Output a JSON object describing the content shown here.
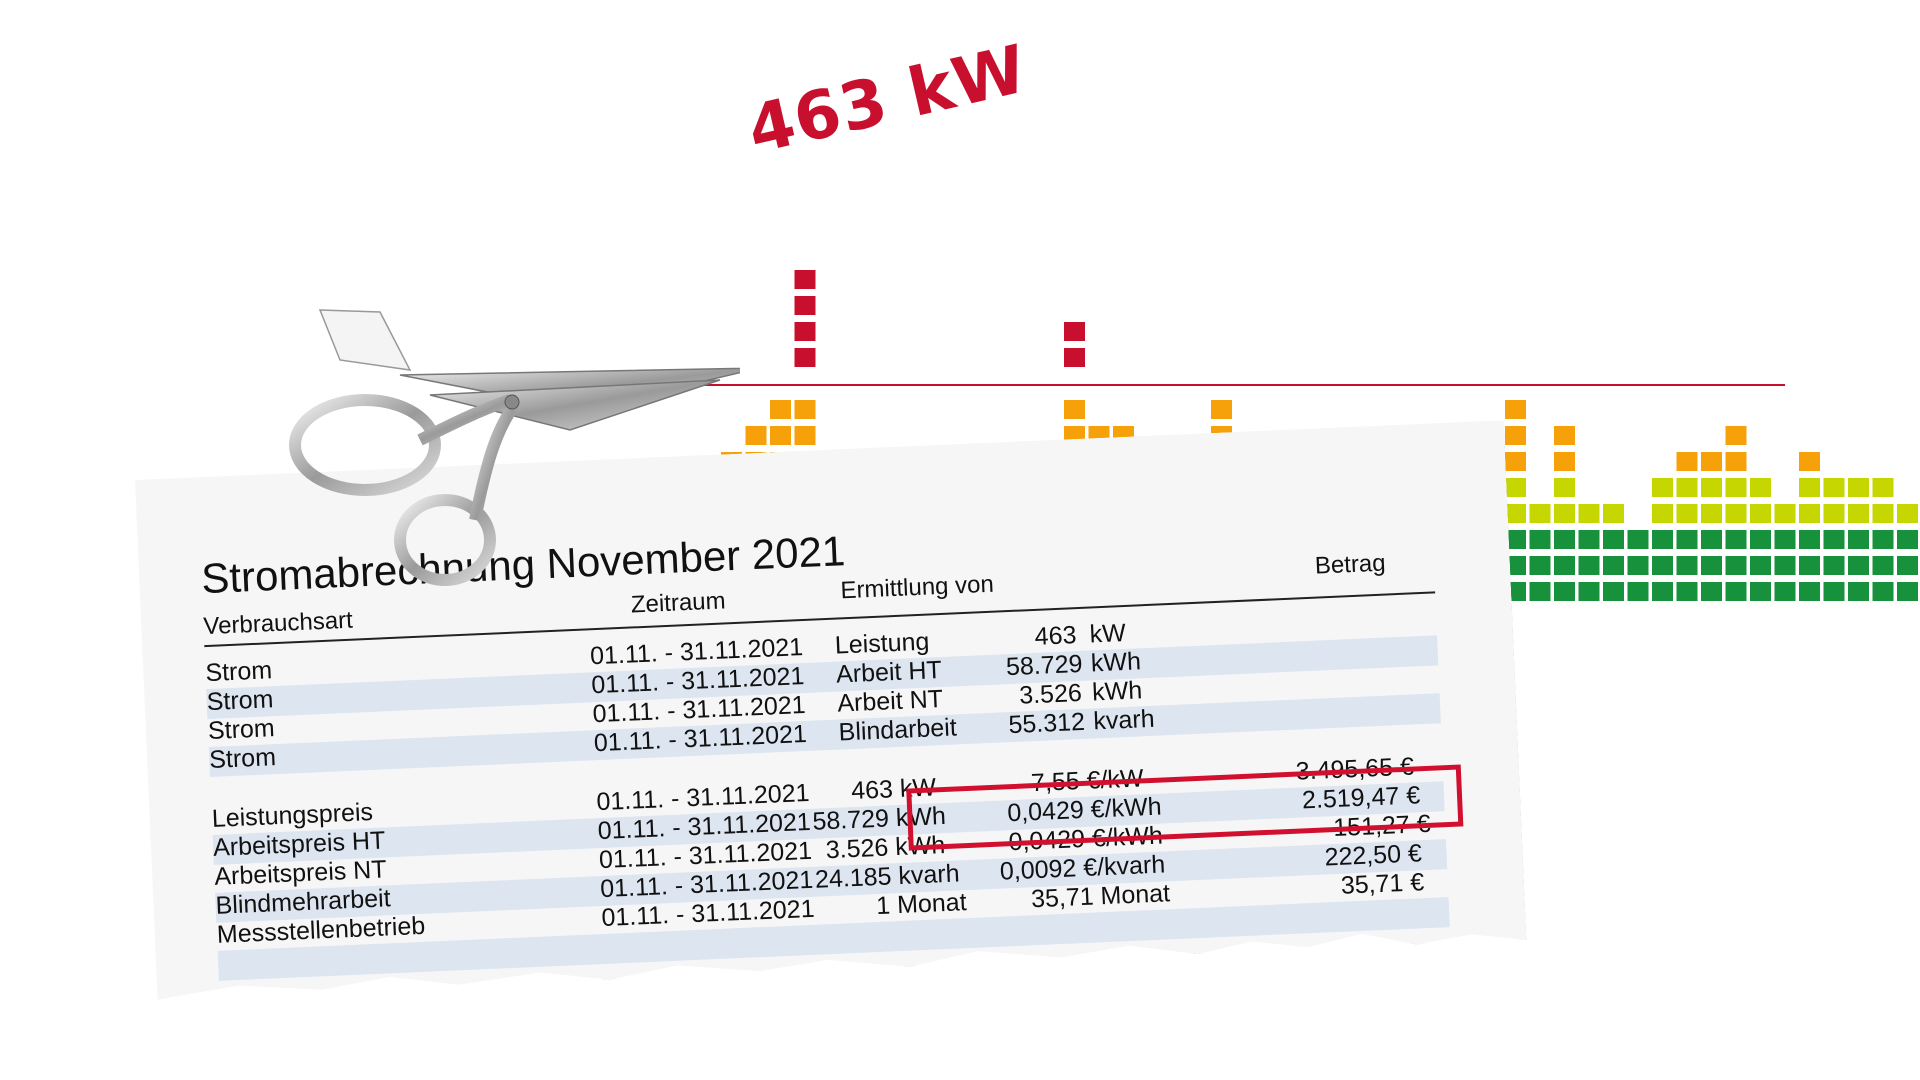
{
  "peak_label": "463 kW",
  "colors": {
    "peak_red": "#c8102e",
    "orange": "#f6a10a",
    "yellow": "#c5d600",
    "green": "#17913c",
    "highlight_red": "#d11030"
  },
  "meter_levels": [
    4,
    0,
    0,
    4,
    0,
    4,
    6,
    7,
    8,
    12,
    0,
    5,
    4,
    0,
    0,
    6,
    4,
    5,
    6,
    3,
    10,
    7,
    7,
    5,
    4,
    5,
    8,
    6,
    5,
    6,
    5,
    4,
    4,
    3,
    3,
    4,
    5,
    5,
    8,
    4,
    7,
    4,
    4,
    3,
    5,
    6,
    6,
    7,
    5,
    4,
    6,
    5,
    5,
    5,
    4,
    4,
    5,
    6,
    7,
    6
  ],
  "bill": {
    "title": "Stromabrechnung November 2021",
    "headers": {
      "type": "Verbrauchsart",
      "period": "Zeitraum",
      "calc": "Ermittlung von",
      "amount": "Betrag"
    },
    "usage_rows": [
      {
        "type": "Strom",
        "period": "01.11. - 31.11.2021",
        "calc": "Leistung",
        "qty": "463",
        "unit": "kW"
      },
      {
        "type": "Strom",
        "period": "01.11. - 31.11.2021",
        "calc": "Arbeit HT",
        "qty": "58.729",
        "unit": "kWh"
      },
      {
        "type": "Strom",
        "period": "01.11. - 31.11.2021",
        "calc": "Arbeit NT",
        "qty": "3.526",
        "unit": "kWh"
      },
      {
        "type": "Strom",
        "period": "01.11. - 31.11.2021",
        "calc": "Blindarbeit",
        "qty": "55.312",
        "unit": "kvarh"
      }
    ],
    "price_rows": [
      {
        "type": "Leistungspreis",
        "period": "01.11. - 31.11.2021",
        "qty": "463 kW",
        "rate": "7,55 €/kW",
        "amount": "3.495,65 €"
      },
      {
        "type": "Arbeitspreis HT",
        "period": "01.11. - 31.11.2021",
        "qty": "58.729 kWh",
        "rate": "0,0429 €/kWh",
        "amount": "2.519,47 €"
      },
      {
        "type": "Arbeitspreis NT",
        "period": "01.11. - 31.11.2021",
        "qty": "3.526 kWh",
        "rate": "0,0429 €/kWh",
        "amount": "151,27 €"
      },
      {
        "type": "Blindmehrarbeit",
        "period": "01.11. - 31.11.2021",
        "qty": "24.185 kvarh",
        "rate": "0,0092 €/kvarh",
        "amount": "222,50 €"
      },
      {
        "type": "Messstellenbetrieb",
        "period": "01.11. - 31.11.2021",
        "qty": "1 Monat",
        "rate": "35,71 Monat",
        "amount": "35,71 €"
      }
    ]
  }
}
